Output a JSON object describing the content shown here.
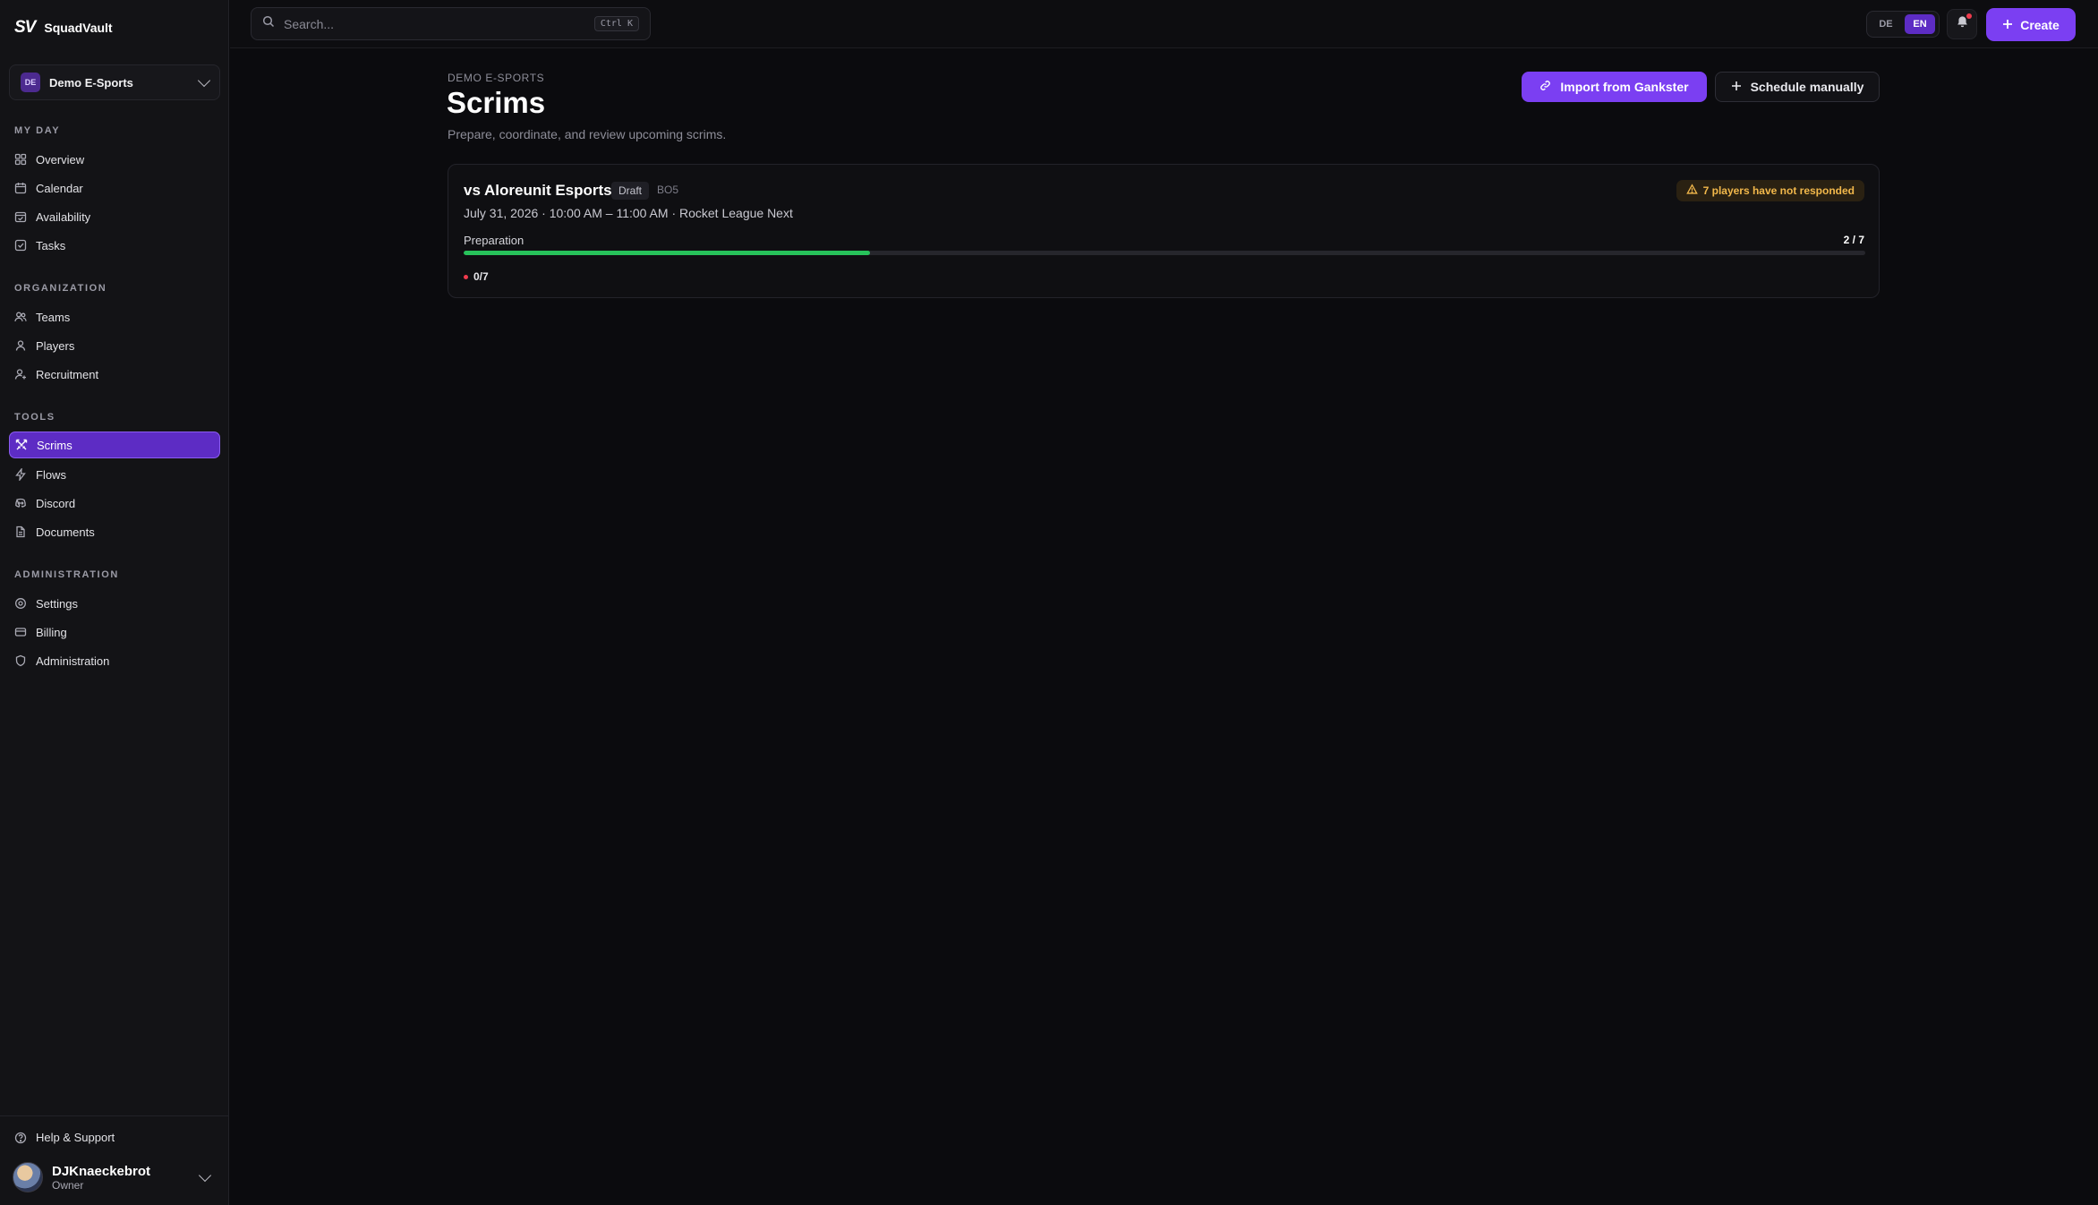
{
  "brand": {
    "logo": "SV",
    "name": "SquadVault"
  },
  "org": {
    "initials": "DE",
    "name": "Demo E-Sports"
  },
  "sidebar": {
    "sections": [
      {
        "label": "MY DAY",
        "items": [
          "Overview",
          "Calendar",
          "Availability",
          "Tasks"
        ]
      },
      {
        "label": "ORGANIZATION",
        "items": [
          "Teams",
          "Players",
          "Recruitment"
        ]
      },
      {
        "label": "TOOLS",
        "items": [
          "Scrims",
          "Flows",
          "Discord",
          "Documents"
        ]
      },
      {
        "label": "ADMINISTRATION",
        "items": [
          "Settings",
          "Billing",
          "Administration"
        ]
      }
    ],
    "active": "Scrims",
    "help": "Help & Support",
    "user": {
      "name": "DJKnaeckebrot",
      "role": "Owner"
    }
  },
  "topbar": {
    "search_placeholder": "Search...",
    "shortcut": "Ctrl K",
    "lang": [
      "DE",
      "EN"
    ],
    "lang_active": "EN",
    "create_label": "Create"
  },
  "page": {
    "breadcrumb": "DEMO E-SPORTS",
    "title": "Scrims",
    "subtitle": "Prepare, coordinate, and review upcoming scrims.",
    "import_label": "Import from Gankster",
    "schedule_label": "Schedule manually"
  },
  "scrims": [
    {
      "title": "vs Aloreunit Esports",
      "status": "Draft",
      "format": "BO5",
      "meta": "July 31, 2026 · 10:00 AM – 11:00 AM · Rocket League Next",
      "warning": "7 players have not responded",
      "prep_label": "Preparation",
      "prep_count": "2 / 7",
      "prep_progress": 0.29,
      "responses": "0/7"
    }
  ],
  "colors": {
    "accent": "#7b3ff2",
    "success": "#27c25a",
    "warning": "#f2b84b",
    "danger": "#ef3b4d"
  }
}
